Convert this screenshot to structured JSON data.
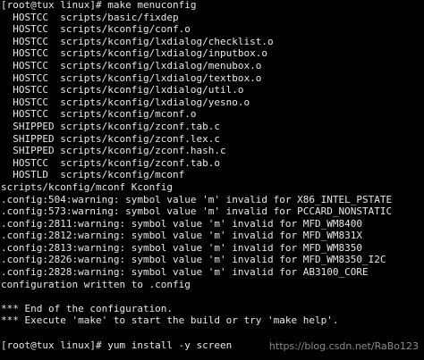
{
  "terminal": {
    "text_color": "#e8e8e8",
    "background": "#000000",
    "lines": [
      "[root@tux linux]# make menuconfig",
      "  HOSTCC  scripts/basic/fixdep",
      "  HOSTCC  scripts/kconfig/conf.o",
      "  HOSTCC  scripts/kconfig/lxdialog/checklist.o",
      "  HOSTCC  scripts/kconfig/lxdialog/inputbox.o",
      "  HOSTCC  scripts/kconfig/lxdialog/menubox.o",
      "  HOSTCC  scripts/kconfig/lxdialog/textbox.o",
      "  HOSTCC  scripts/kconfig/lxdialog/util.o",
      "  HOSTCC  scripts/kconfig/lxdialog/yesno.o",
      "  HOSTCC  scripts/kconfig/mconf.o",
      "  SHIPPED scripts/kconfig/zconf.tab.c",
      "  SHIPPED scripts/kconfig/zconf.lex.c",
      "  SHIPPED scripts/kconfig/zconf.hash.c",
      "  HOSTCC  scripts/kconfig/zconf.tab.o",
      "  HOSTLD  scripts/kconfig/mconf",
      "scripts/kconfig/mconf Kconfig",
      ".config:504:warning: symbol value 'm' invalid for X86_INTEL_PSTATE",
      ".config:573:warning: symbol value 'm' invalid for PCCARD_NONSTATIC",
      ".config:2811:warning: symbol value 'm' invalid for MFD_WM8400",
      ".config:2812:warning: symbol value 'm' invalid for MFD_WM831X",
      ".config:2813:warning: symbol value 'm' invalid for MFD_WM8350",
      ".config:2826:warning: symbol value 'm' invalid for MFD_WM8350_I2C",
      ".config:2828:warning: symbol value 'm' invalid for AB3100_CORE",
      "configuration written to .config",
      "",
      "*** End of the configuration.",
      "*** Execute 'make' to start the build or try 'make help'.",
      "",
      "[root@tux linux]# yum install -y screen"
    ]
  },
  "watermark": "https://blog.csdn.net/RaBo123"
}
